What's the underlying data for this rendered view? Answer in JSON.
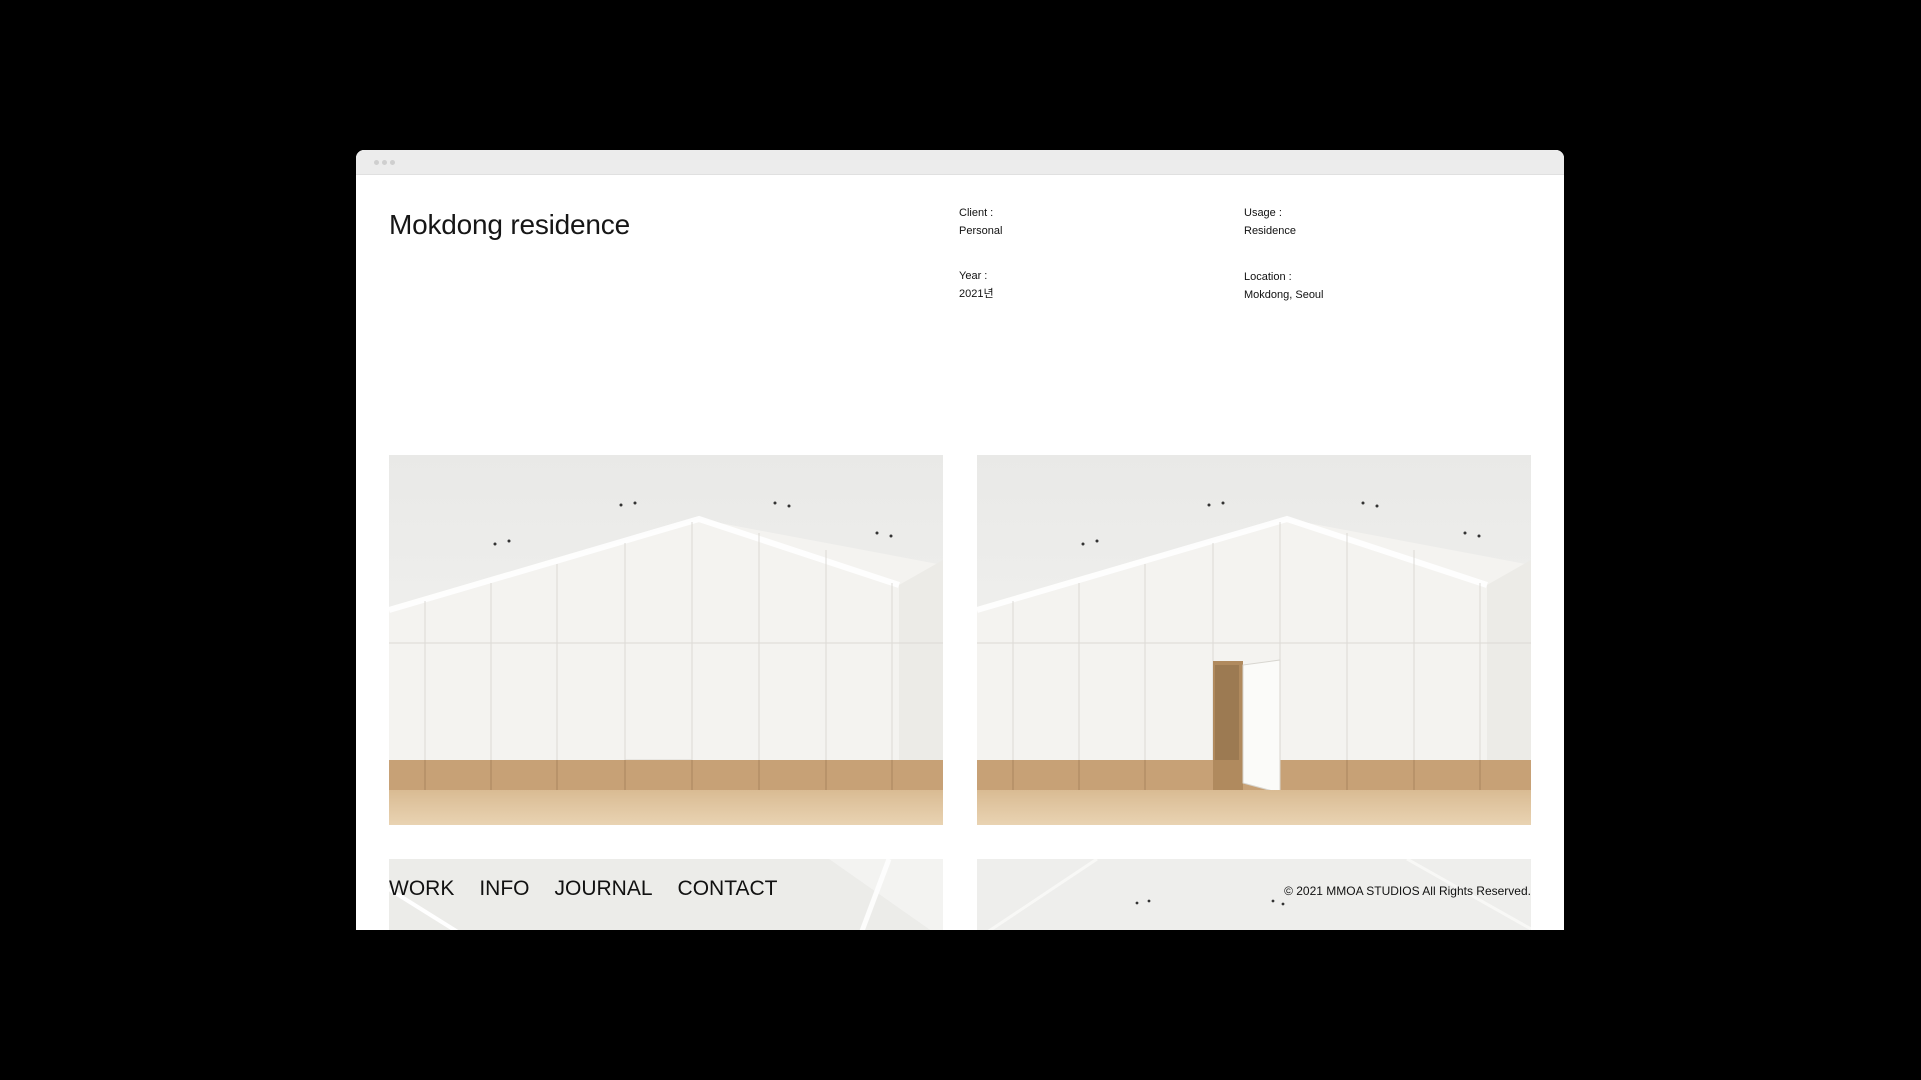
{
  "project": {
    "title": "Mokdong residence",
    "client_label": "Client :",
    "client_value": "Personal",
    "usage_label": "Usage :",
    "usage_value": "Residence",
    "year_label": "Year :",
    "year_value": "2021년",
    "location_label": "Location :",
    "location_value": "Mokdong, Seoul"
  },
  "nav": {
    "work": "WORK",
    "info": "INFO",
    "journal": "JOURNAL",
    "contact": "CONTACT"
  },
  "footer": {
    "copyright": "© 2021 MMOA STUDIOS All Rights Reserved."
  },
  "colors": {
    "background": "#000000",
    "page": "#ffffff",
    "wall": "#f2f1ee",
    "wood": "#c9a47a",
    "floor": "#dcc39f"
  }
}
